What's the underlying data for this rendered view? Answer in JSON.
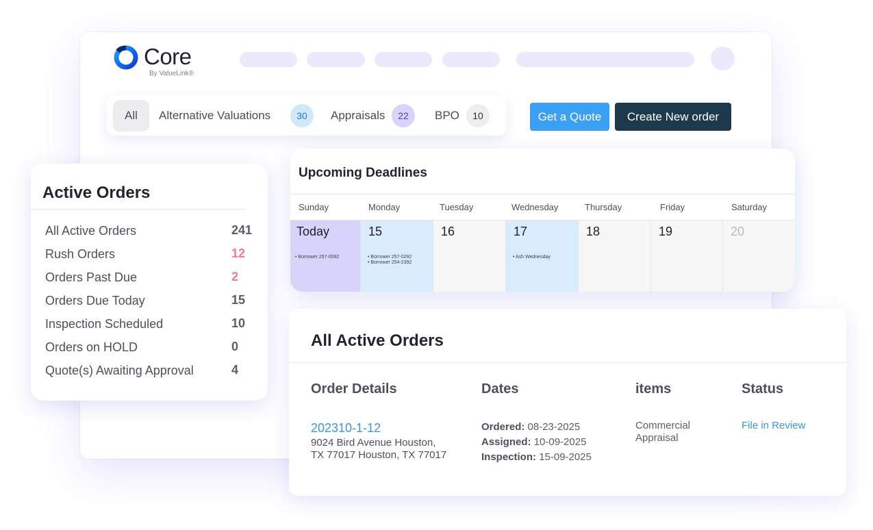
{
  "brand": {
    "name": "Core",
    "tagline": "By ValueLink®",
    "accent": "#1a73e8"
  },
  "tabs": {
    "all_label": "All",
    "items": [
      {
        "label": "Alternative Valuations",
        "count": "30",
        "color": "#cfe9fb",
        "text_color": "#2a7bd4"
      },
      {
        "label": "Appraisals",
        "count": "22",
        "color": "#d9d4fb",
        "text_color": "#4d42b5"
      },
      {
        "label": "BPO",
        "count": "10",
        "color": "#eeeef1",
        "text_color": "#2b2b33"
      }
    ]
  },
  "actions": {
    "quote_label": "Get a Quote",
    "create_label": "Create New order"
  },
  "calendar": {
    "title": "Upcoming Deadlines",
    "days": [
      "Sunday",
      "Monday",
      "Tuesday",
      "Wednesday",
      "Thursday",
      "Friday",
      "Saturday"
    ],
    "cells": [
      {
        "date": "Today",
        "events": [
          "• Borrower 257-0092"
        ],
        "bg": "#d8d3fb"
      },
      {
        "date": "15",
        "events": [
          "• Borrower 257-0292",
          "• Borrower 254-2392"
        ],
        "bg": "#d9ecfc"
      },
      {
        "date": "16",
        "events": [],
        "bg": "#f7f7f8"
      },
      {
        "date": "17",
        "events": [
          "• Ash Wednesday"
        ],
        "bg": "#d9ecfc"
      },
      {
        "date": "18",
        "events": [],
        "bg": "#f7f7f8"
      },
      {
        "date": "19",
        "events": [],
        "bg": "#f7f7f8"
      },
      {
        "date": "20",
        "events": [],
        "bg": "#f7f7f8",
        "muted": true
      }
    ]
  },
  "active_orders": {
    "title": "Active Orders",
    "rows": [
      {
        "label": "All Active Orders",
        "value": "241"
      },
      {
        "label": "Rush Orders",
        "value": "12",
        "color": "#f07c91"
      },
      {
        "label": "Orders Past Due",
        "value": "2",
        "color": "#f07c91"
      },
      {
        "label": "Orders Due Today",
        "value": "15"
      },
      {
        "label": "Inspection Scheduled",
        "value": "10"
      },
      {
        "label": "Orders on HOLD",
        "value": "0"
      },
      {
        "label": "Quote(s) Awaiting Approval",
        "value": "4"
      }
    ]
  },
  "all_orders": {
    "title": "All Active Orders",
    "columns": [
      "Order Details",
      "Dates",
      "items",
      "Status"
    ],
    "order": {
      "id": "202310-1-12",
      "address_line1": "9024 Bird Avenue Houston,",
      "address_line2": "TX 77017 Houston, TX 77017",
      "ordered_label": "Ordered:",
      "ordered": "08-23-2025",
      "assigned_label": "Assigned:",
      "assigned": "10-09-2025",
      "inspection_label": "Inspection:",
      "inspection": "15-09-2025",
      "item_line1": "Commercial",
      "item_line2": "Appraisal",
      "status": "File in Review"
    }
  }
}
